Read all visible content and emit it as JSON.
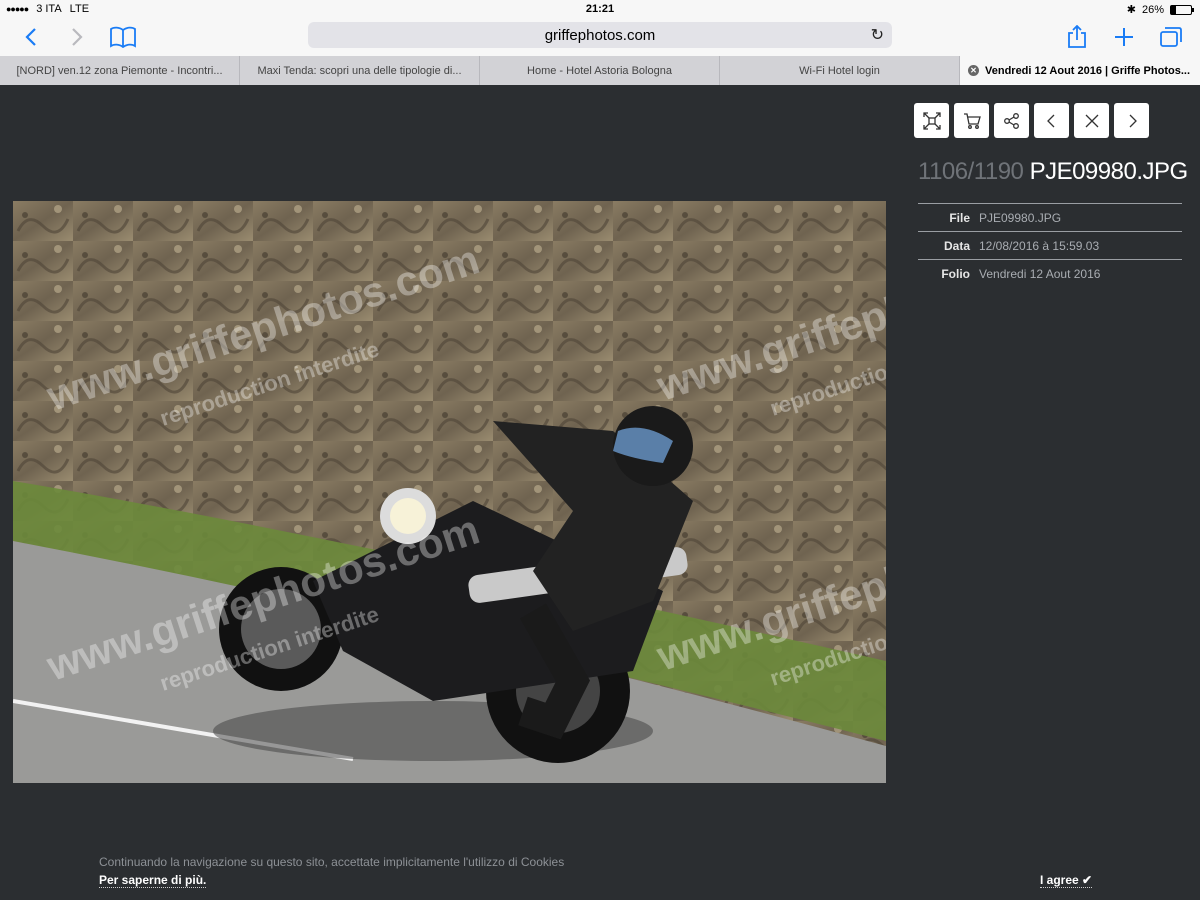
{
  "status_bar": {
    "carrier": "3 ITA",
    "network": "LTE",
    "time": "21:21",
    "battery": "26%",
    "battery_level": 0.26
  },
  "browser": {
    "url": "griffephotos.com",
    "tabs": [
      {
        "label": "[NORD] ven.12 zona Piemonte - Incontri..."
      },
      {
        "label": "Maxi Tenda: scopri una delle tipologie di..."
      },
      {
        "label": "Home - Hotel Astoria Bologna"
      },
      {
        "label": "Wi-Fi Hotel login"
      },
      {
        "label": "Vendredi 12 Aout 2016 | Griffe Photos...",
        "active": true
      }
    ]
  },
  "photo": {
    "counter": "1106/1190",
    "filename": "PJE09980.JPG",
    "watermark_line1": "www.griffephotos.com",
    "watermark_line2": "reproduction interdite"
  },
  "meta": [
    {
      "key": "File",
      "value": "PJE09980.JPG"
    },
    {
      "key": "Data",
      "value": "12/08/2016 à 15:59.03"
    },
    {
      "key": "Folio",
      "value": "Vendredi 12 Aout 2016"
    }
  ],
  "cookie": {
    "message": "Continuando la navigazione su questo sito, accettate implicitamente l'utilizzo di Cookies",
    "more_link": "Per saperne di più.",
    "agree_label": "I agree ✔"
  },
  "colors": {
    "accent": "#1a7cf5",
    "page_bg": "#2b2e31"
  },
  "icons": [
    "back-icon",
    "forward-icon",
    "bookmarks-icon",
    "reload-icon",
    "share-icon",
    "new-tab-icon",
    "tabs-icon",
    "fullscreen-icon",
    "cart-icon",
    "share-nodes-icon",
    "prev-icon",
    "close-icon",
    "next-icon",
    "bluetooth-icon"
  ]
}
